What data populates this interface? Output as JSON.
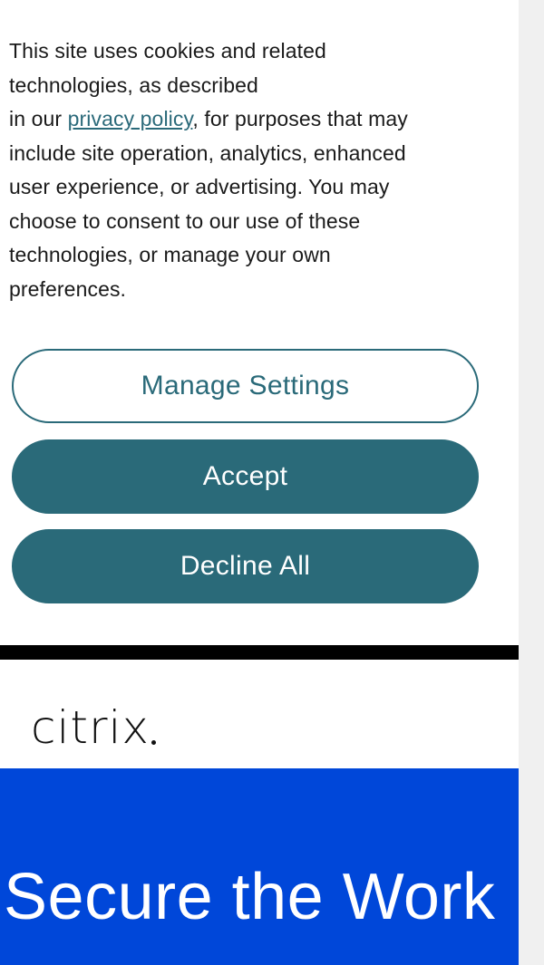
{
  "cookie_banner": {
    "text_lines": {
      "l1": "This site uses cookies and related",
      "l2": "technologies, as described",
      "l3_prefix": "in our ",
      "l3_link": "privacy policy",
      "l3_suffix": ", for purposes that may",
      "l4": "include site operation, analytics, enhanced",
      "l5": "user experience, or advertising. You may",
      "l6": "choose to consent to our use of these",
      "l7": "technologies, or manage your own",
      "l8": "preferences."
    },
    "buttons": {
      "manage_label": "Manage Settings",
      "accept_label": "Accept",
      "decline_label": "Decline All"
    },
    "colors": {
      "accent": "#2a6a79",
      "link": "#2b6a7a"
    }
  },
  "header": {
    "logo_text": "citrix",
    "logo_icon": "citrix-logo"
  },
  "hero": {
    "title": "Secure the Work",
    "background": "#0047d9"
  }
}
